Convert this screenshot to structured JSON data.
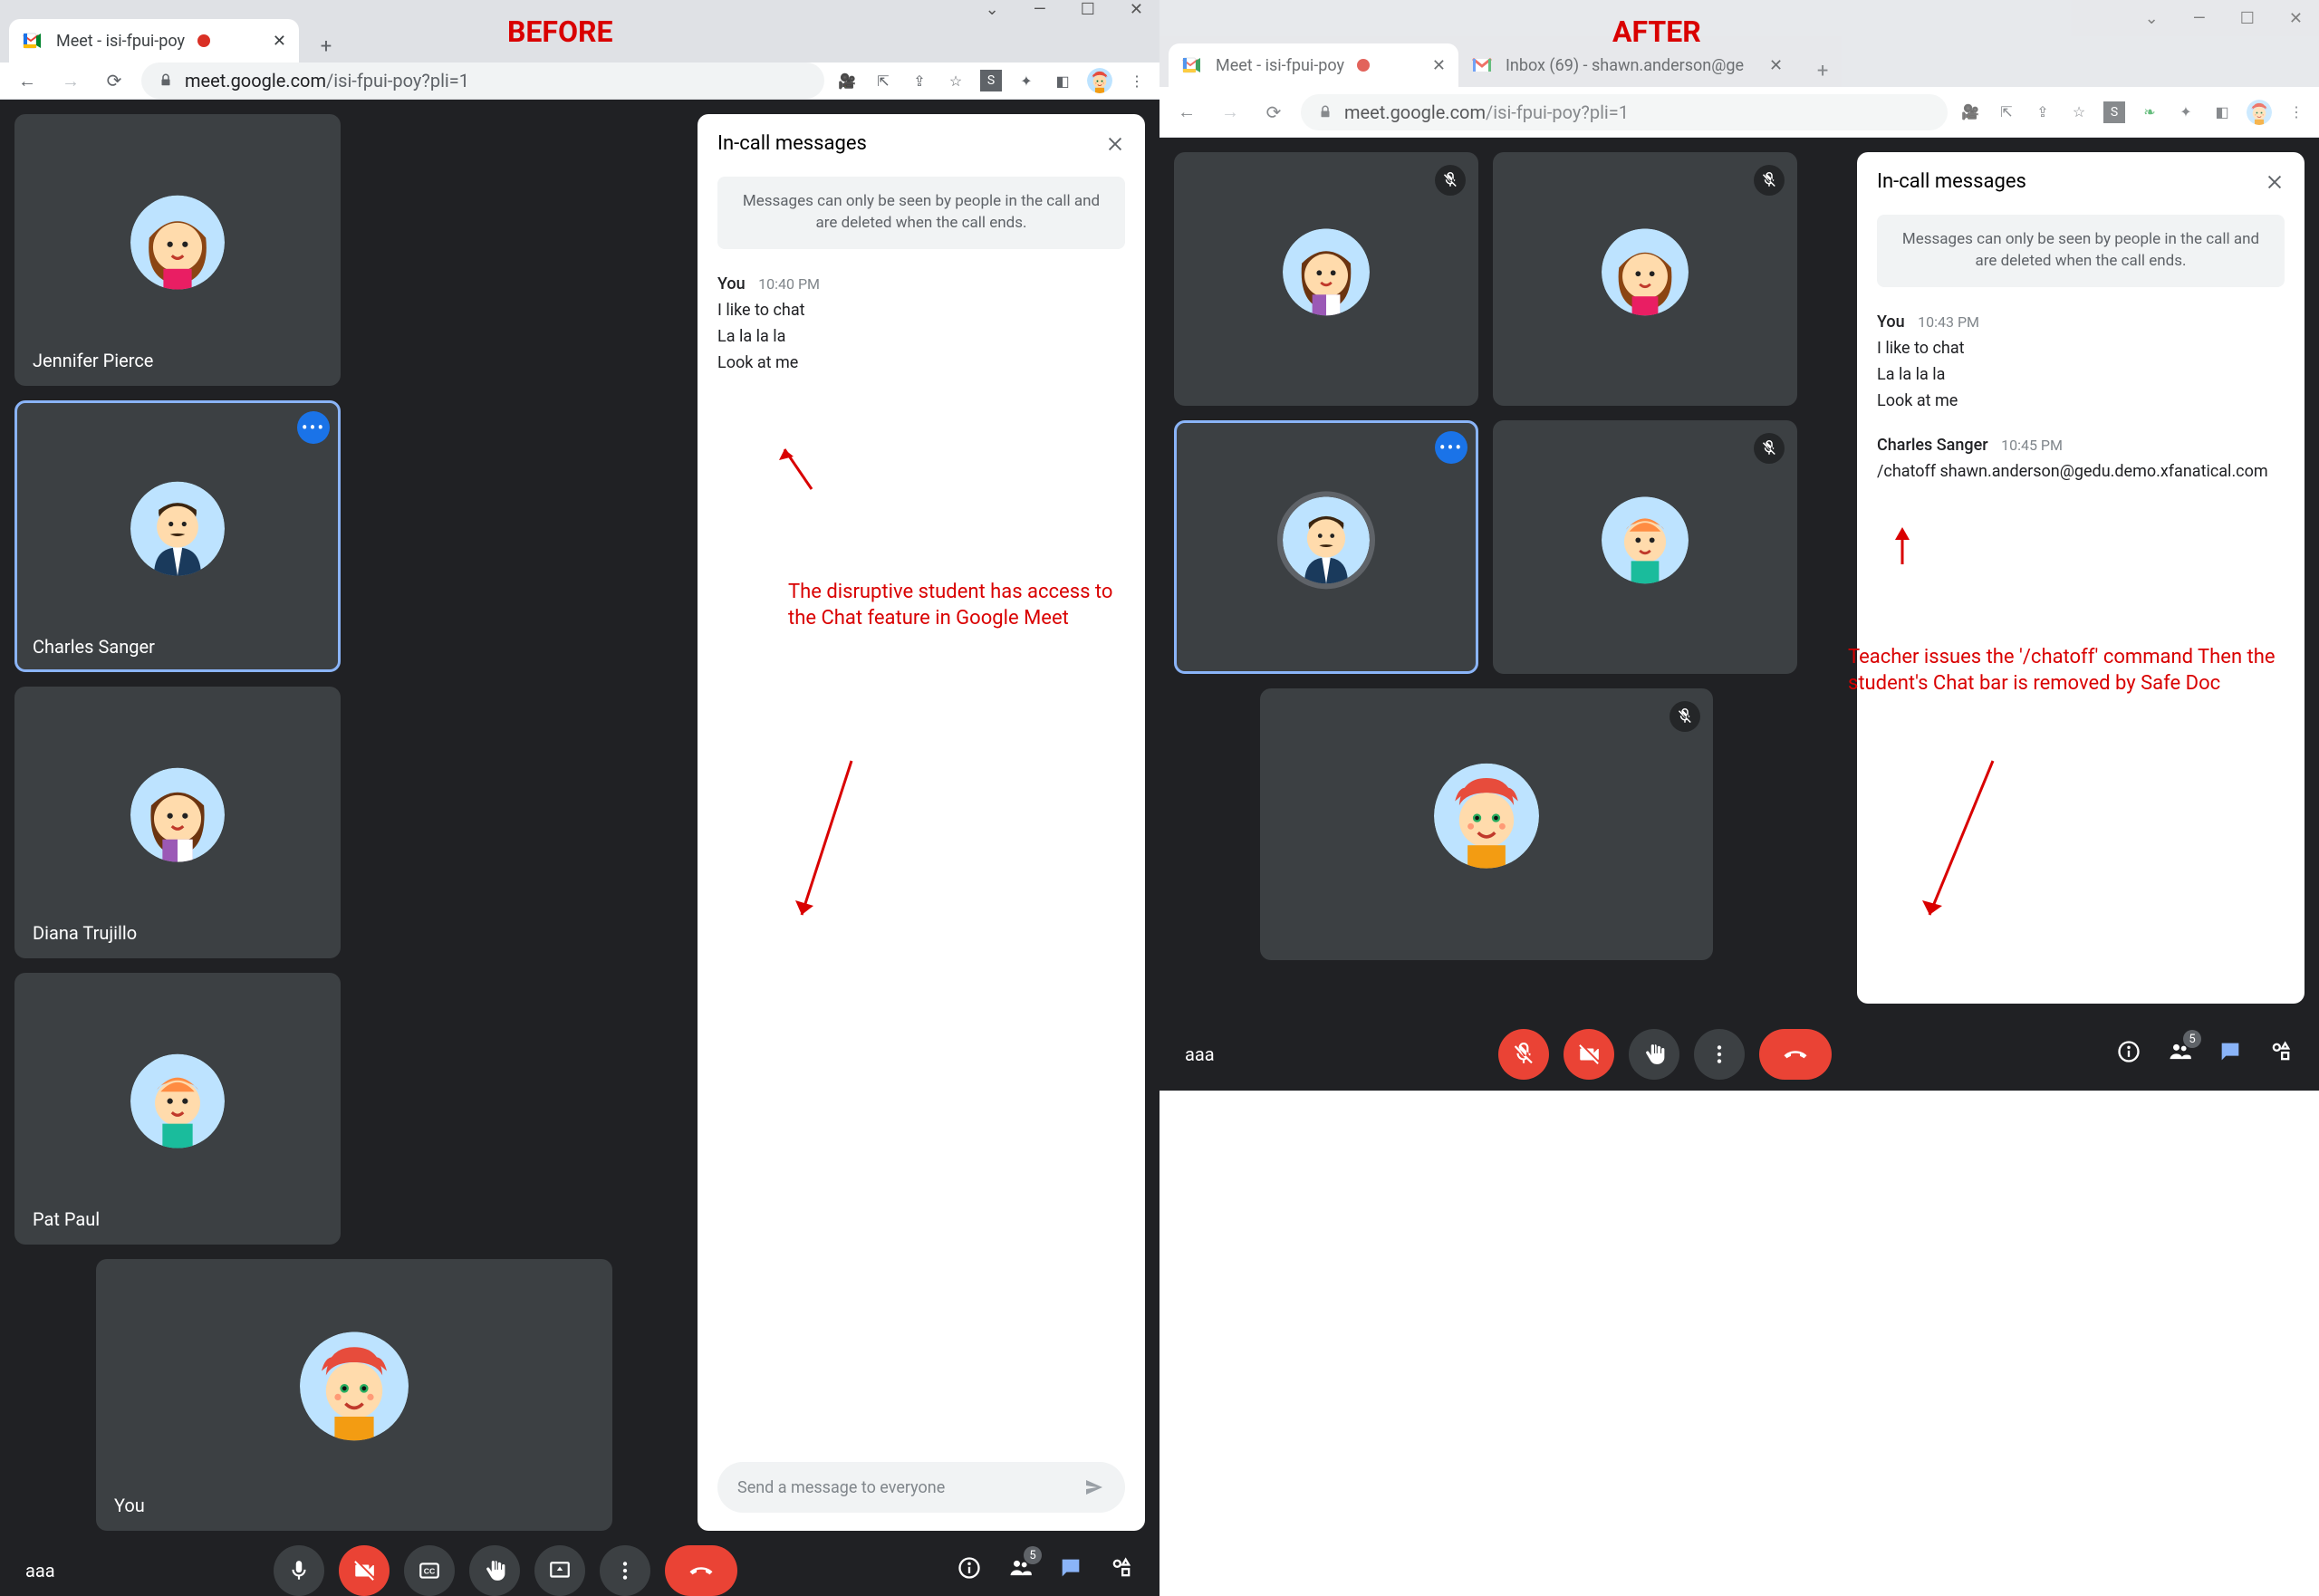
{
  "before_label": "BEFORE",
  "after_label": "AFTER",
  "tab_title": "Meet - isi-fpui-poy",
  "tab2_title": "Inbox (69) - shawn.anderson@ge",
  "url_host": "meet.google.com",
  "url_path": "/isi-fpui-poy?pli=1",
  "meeting_code": "aaa",
  "chat_title": "In-call messages",
  "chat_notice": "Messages can only be seen by people in the call and are deleted when the call ends.",
  "chat_placeholder": "Send a message to everyone",
  "participants": {
    "p1": "Jennifer Pierce",
    "p2": "Charles Sanger",
    "p3": "Diana Trujillo",
    "p4": "Pat Paul",
    "you": "You"
  },
  "participants_count": "5",
  "before": {
    "msg_sender": "You",
    "msg_time": "10:40 PM",
    "l1": "I like to chat",
    "l2": "La la la la",
    "l3": "Look at me",
    "annotation": "The disruptive student has access to the Chat feature in Google Meet"
  },
  "after": {
    "msg1_sender": "You",
    "msg1_time": "10:43 PM",
    "msg1_l1": "I like to chat",
    "msg1_l2": "La la la la",
    "msg1_l3": "Look at me",
    "msg2_sender": "Charles Sanger",
    "msg2_time": "10:45 PM",
    "msg2_l1": "/chatoff shawn.anderson@gedu.demo.xfanatical.com",
    "annotation": "Teacher issues the '/chatoff' command Then the student's Chat bar is removed by Safe Doc"
  }
}
